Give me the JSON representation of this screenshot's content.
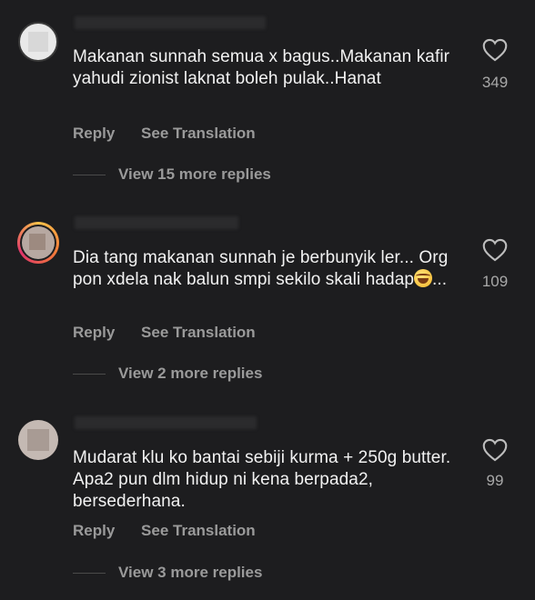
{
  "comments": [
    {
      "text": "Makanan sunnah semua x bagus..Makanan kafir yahudi zionist laknat boleh pulak..Hanat",
      "likes": "349",
      "reply_label": "Reply",
      "translate_label": "See Translation",
      "more_replies": "View 15 more replies"
    },
    {
      "text_before_emoji": "Dia tang makanan sunnah je berbunyik ler... Org pon xdela nak balun smpi sekilo skali hadap",
      "emoji": "grinning-sweat-emoji",
      "text_after_emoji": "...",
      "likes": "109",
      "reply_label": "Reply",
      "translate_label": "See Translation",
      "more_replies": "View 2 more replies"
    },
    {
      "text": "Mudarat klu ko bantai sebiji kurma + 250g butter. Apa2 pun dlm hidup ni kena berpada2, bersederhana.",
      "likes": "99",
      "reply_label": "Reply",
      "translate_label": "See Translation",
      "more_replies": "View 3 more replies"
    }
  ],
  "icons": {
    "like": "heart-outline-icon"
  },
  "colors": {
    "background": "#1d1d1f",
    "text": "#f2f2f2",
    "secondary": "#9a9a9a"
  }
}
